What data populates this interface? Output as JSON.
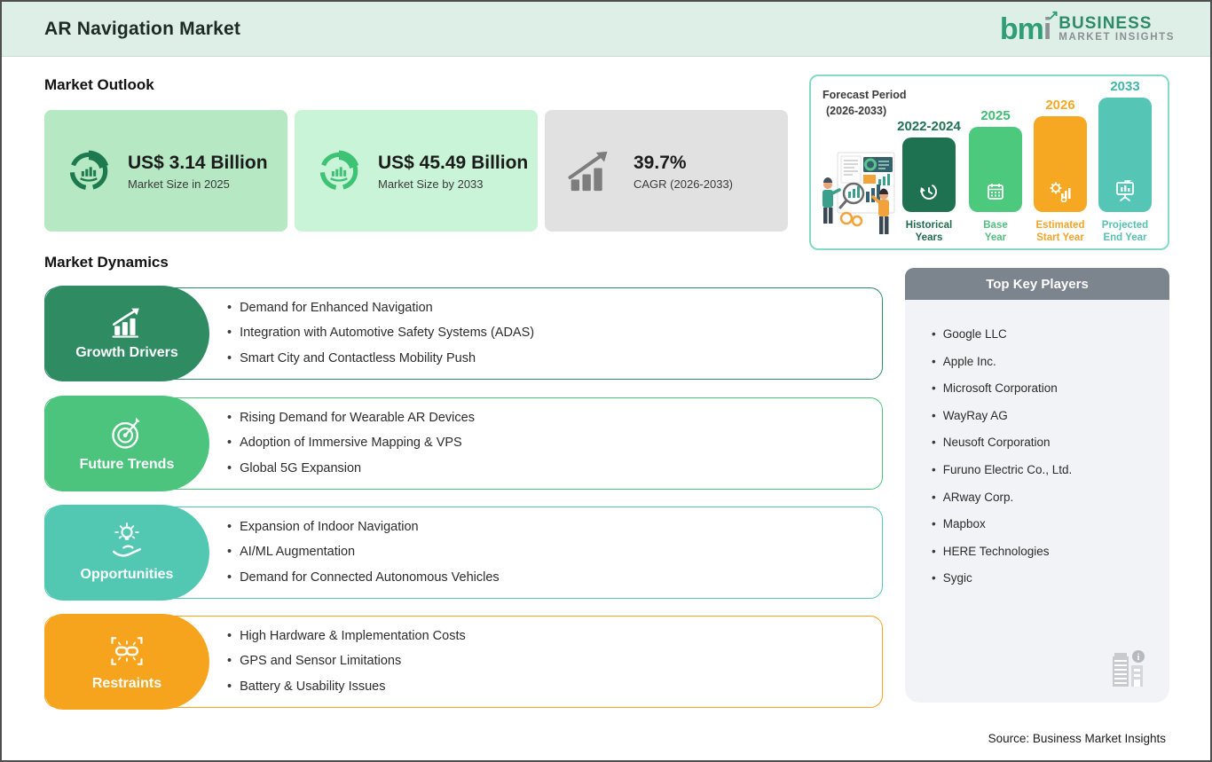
{
  "header": {
    "title": "AR Navigation Market",
    "logo": {
      "mark_green": "bm",
      "mark_gray": "i",
      "arrow": "↗",
      "line1": "BUSINESS",
      "line2": "MARKET  INSIGHTS"
    }
  },
  "market_outlook": {
    "heading": "Market Outlook",
    "cards": [
      {
        "icon": "donut-chart-icon",
        "value": "US$ 3.14 Billion",
        "sub": "Market Size in 2025"
      },
      {
        "icon": "donut-chart-icon",
        "value": "US$ 45.49 Billion",
        "sub": "Market Size by 2033"
      },
      {
        "icon": "growth-arrow-icon",
        "value": "39.7%",
        "sub": "CAGR (2026-2033)"
      }
    ]
  },
  "forecast_panel": {
    "title_line1": "Forecast Period",
    "title_line2": "(2026-2033)",
    "bars": [
      {
        "year": "2022-2024",
        "label": "Historical Years",
        "icon": "history-clock-icon",
        "color": "#1f7251"
      },
      {
        "year": "2025",
        "label": "Base Year",
        "icon": "calendar-icon",
        "color": "#4cc97d"
      },
      {
        "year": "2026",
        "label": "Estimated Start Year",
        "icon": "gear-chart-icon",
        "color": "#f7a823"
      },
      {
        "year": "2033",
        "label": "Projected End Year",
        "icon": "presentation-icon",
        "color": "#55c6b5"
      }
    ],
    "bar_labels": {
      "b1l1": "Historical",
      "b1l2": "Years",
      "b2l1": "Base",
      "b2l2": "Year",
      "b3l1": "Estimated",
      "b3l2": "Start Year",
      "b4l1": "Projected",
      "b4l2": "End Year"
    }
  },
  "chart_data": {
    "type": "bar",
    "title": "Forecast Period (2026-2033)",
    "categories": [
      "2022-2024",
      "2025",
      "2026",
      "2033"
    ],
    "series": [
      {
        "name": "timeline",
        "values": [
          84,
          96,
          108,
          129
        ]
      }
    ],
    "value_note": "no numeric axis shown; values are relative bar heights in px (illustrative timeline)",
    "category_roles": [
      "Historical Years",
      "Base Year",
      "Estimated Start Year",
      "Projected End Year"
    ],
    "bar_colors": [
      "#1f7251",
      "#4cc97d",
      "#f7a823",
      "#55c6b5"
    ],
    "legend": "none",
    "grid": false,
    "key_metrics": {
      "market_size_2025": "US$ 3.14 Billion",
      "market_size_2033": "US$ 45.49 Billion",
      "cagr_2026_2033": "39.7%"
    }
  },
  "market_dynamics": {
    "heading": "Market Dynamics",
    "rows": [
      {
        "label": "Growth Drivers",
        "icon": "bar-chart-arrow-icon",
        "color": "#2e8b62",
        "bullets": [
          "Demand for Enhanced Navigation",
          "Integration with Automotive Safety Systems (ADAS)",
          "Smart City and Contactless Mobility Push"
        ]
      },
      {
        "label": "Future Trends",
        "icon": "target-dart-icon",
        "color": "#4cc47d",
        "bullets": [
          "Rising Demand for Wearable AR Devices",
          "Adoption of Immersive Mapping & VPS",
          "Global 5G Expansion"
        ]
      },
      {
        "label": "Opportunities",
        "icon": "hand-lightbulb-icon",
        "color": "#52c8b3",
        "bullets": [
          "Expansion of Indoor Navigation",
          "AI/ML Augmentation",
          "Demand for Connected Autonomous Vehicles"
        ]
      },
      {
        "label": "Restraints",
        "icon": "chain-link-icon",
        "color": "#f6a41e",
        "bullets": [
          "High Hardware & Implementation Costs",
          "GPS and Sensor Limitations",
          "Battery & Usability Issues"
        ]
      }
    ]
  },
  "key_players": {
    "heading": "Top Key Players",
    "items": [
      "Google LLC",
      "Apple Inc.",
      "Microsoft Corporation",
      "WayRay AG",
      "Neusoft Corporation",
      "Furuno Electric Co., Ltd.",
      "ARway Corp.",
      "Mapbox",
      "HERE Technologies",
      "Sygic"
    ]
  },
  "source": "Source: Business Market Insights",
  "colors": {
    "header_bg": "#ddefe6",
    "card1_bg": "#b5e8c3",
    "card2_bg": "#c9f4d7",
    "card3_bg": "#e1e1e1",
    "dark_green": "#2e8b62",
    "mid_green": "#4cc47d",
    "teal": "#52c8b3",
    "orange": "#f6a41e",
    "players_header_bg": "#7c848d",
    "players_body_bg": "#f1f3f6",
    "forecast_border": "#86d9c6",
    "logo_green": "#2f9e78",
    "logo_gray": "#8a8f93"
  }
}
